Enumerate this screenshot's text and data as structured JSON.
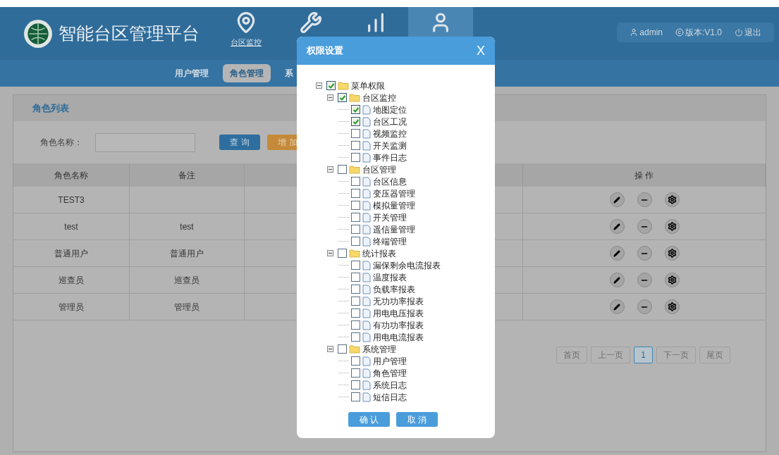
{
  "header": {
    "title": "智能台区管理平台",
    "nav": [
      {
        "label": "台区监控",
        "selected": false
      },
      {
        "selected": false
      },
      {
        "selected": false
      },
      {
        "selected": true
      }
    ],
    "user": "admin",
    "version": "版本:V1.0",
    "logout": "退出"
  },
  "subnav": [
    {
      "label": "用户管理",
      "selected": false
    },
    {
      "label": "角色管理",
      "selected": true
    },
    {
      "label": "系",
      "selected": false
    }
  ],
  "panel": {
    "title": "角色列表",
    "search_label": "角色名称：",
    "query_button": "查 询",
    "add_button": "增 加"
  },
  "table": {
    "columns": [
      "角色名称",
      "备注",
      "",
      "操 作"
    ],
    "rows": [
      [
        "TEST3",
        ""
      ],
      [
        "test",
        "test"
      ],
      [
        "普通用户",
        "普通用户"
      ],
      [
        "巡查员",
        "巡查员"
      ],
      [
        "管理员",
        "管理员"
      ]
    ]
  },
  "pagination": [
    {
      "label": "首页",
      "selected": false
    },
    {
      "label": "上一页",
      "selected": false
    },
    {
      "label": "1",
      "selected": true
    },
    {
      "label": "下一页",
      "selected": false
    },
    {
      "label": "尾页",
      "selected": false
    }
  ],
  "dialog": {
    "title": "权限设置",
    "close": "X",
    "tree": [
      {
        "kind": "folder",
        "label": "菜单权限",
        "checked": true,
        "expanded": true,
        "children": [
          {
            "kind": "folder",
            "label": "台区监控",
            "checked": true,
            "expanded": true,
            "children": [
              {
                "kind": "file",
                "label": "地图定位",
                "checked": true
              },
              {
                "kind": "file",
                "label": "台区工况",
                "checked": true
              },
              {
                "kind": "file",
                "label": "视频监控",
                "checked": false
              },
              {
                "kind": "file",
                "label": "开关监测",
                "checked": false
              },
              {
                "kind": "file",
                "label": "事件日志",
                "checked": false
              }
            ]
          },
          {
            "kind": "folder",
            "label": "台区管理",
            "checked": false,
            "expanded": true,
            "children": [
              {
                "kind": "file",
                "label": "台区信息",
                "checked": false
              },
              {
                "kind": "file",
                "label": "变压器管理",
                "checked": false
              },
              {
                "kind": "file",
                "label": "模拟量管理",
                "checked": false
              },
              {
                "kind": "file",
                "label": "开关管理",
                "checked": false
              },
              {
                "kind": "file",
                "label": "遥信量管理",
                "checked": false
              },
              {
                "kind": "file",
                "label": "终端管理",
                "checked": false
              }
            ]
          },
          {
            "kind": "folder",
            "label": "统计报表",
            "checked": false,
            "expanded": true,
            "children": [
              {
                "kind": "file",
                "label": "漏保剩余电流报表",
                "checked": false
              },
              {
                "kind": "file",
                "label": "温度报表",
                "checked": false
              },
              {
                "kind": "file",
                "label": "负载率报表",
                "checked": false
              },
              {
                "kind": "file",
                "label": "无功功率报表",
                "checked": false
              },
              {
                "kind": "file",
                "label": "用电电压报表",
                "checked": false
              },
              {
                "kind": "file",
                "label": "有功功率报表",
                "checked": false
              },
              {
                "kind": "file",
                "label": "用电电流报表",
                "checked": false
              }
            ]
          },
          {
            "kind": "folder",
            "label": "系统管理",
            "checked": false,
            "expanded": true,
            "children": [
              {
                "kind": "file",
                "label": "用户管理",
                "checked": false
              },
              {
                "kind": "file",
                "label": "角色管理",
                "checked": false
              },
              {
                "kind": "file",
                "label": "系统日志",
                "checked": false
              },
              {
                "kind": "file",
                "label": "短信日志",
                "checked": false
              }
            ]
          }
        ]
      }
    ],
    "confirm": "确 认",
    "cancel": "取 消"
  }
}
